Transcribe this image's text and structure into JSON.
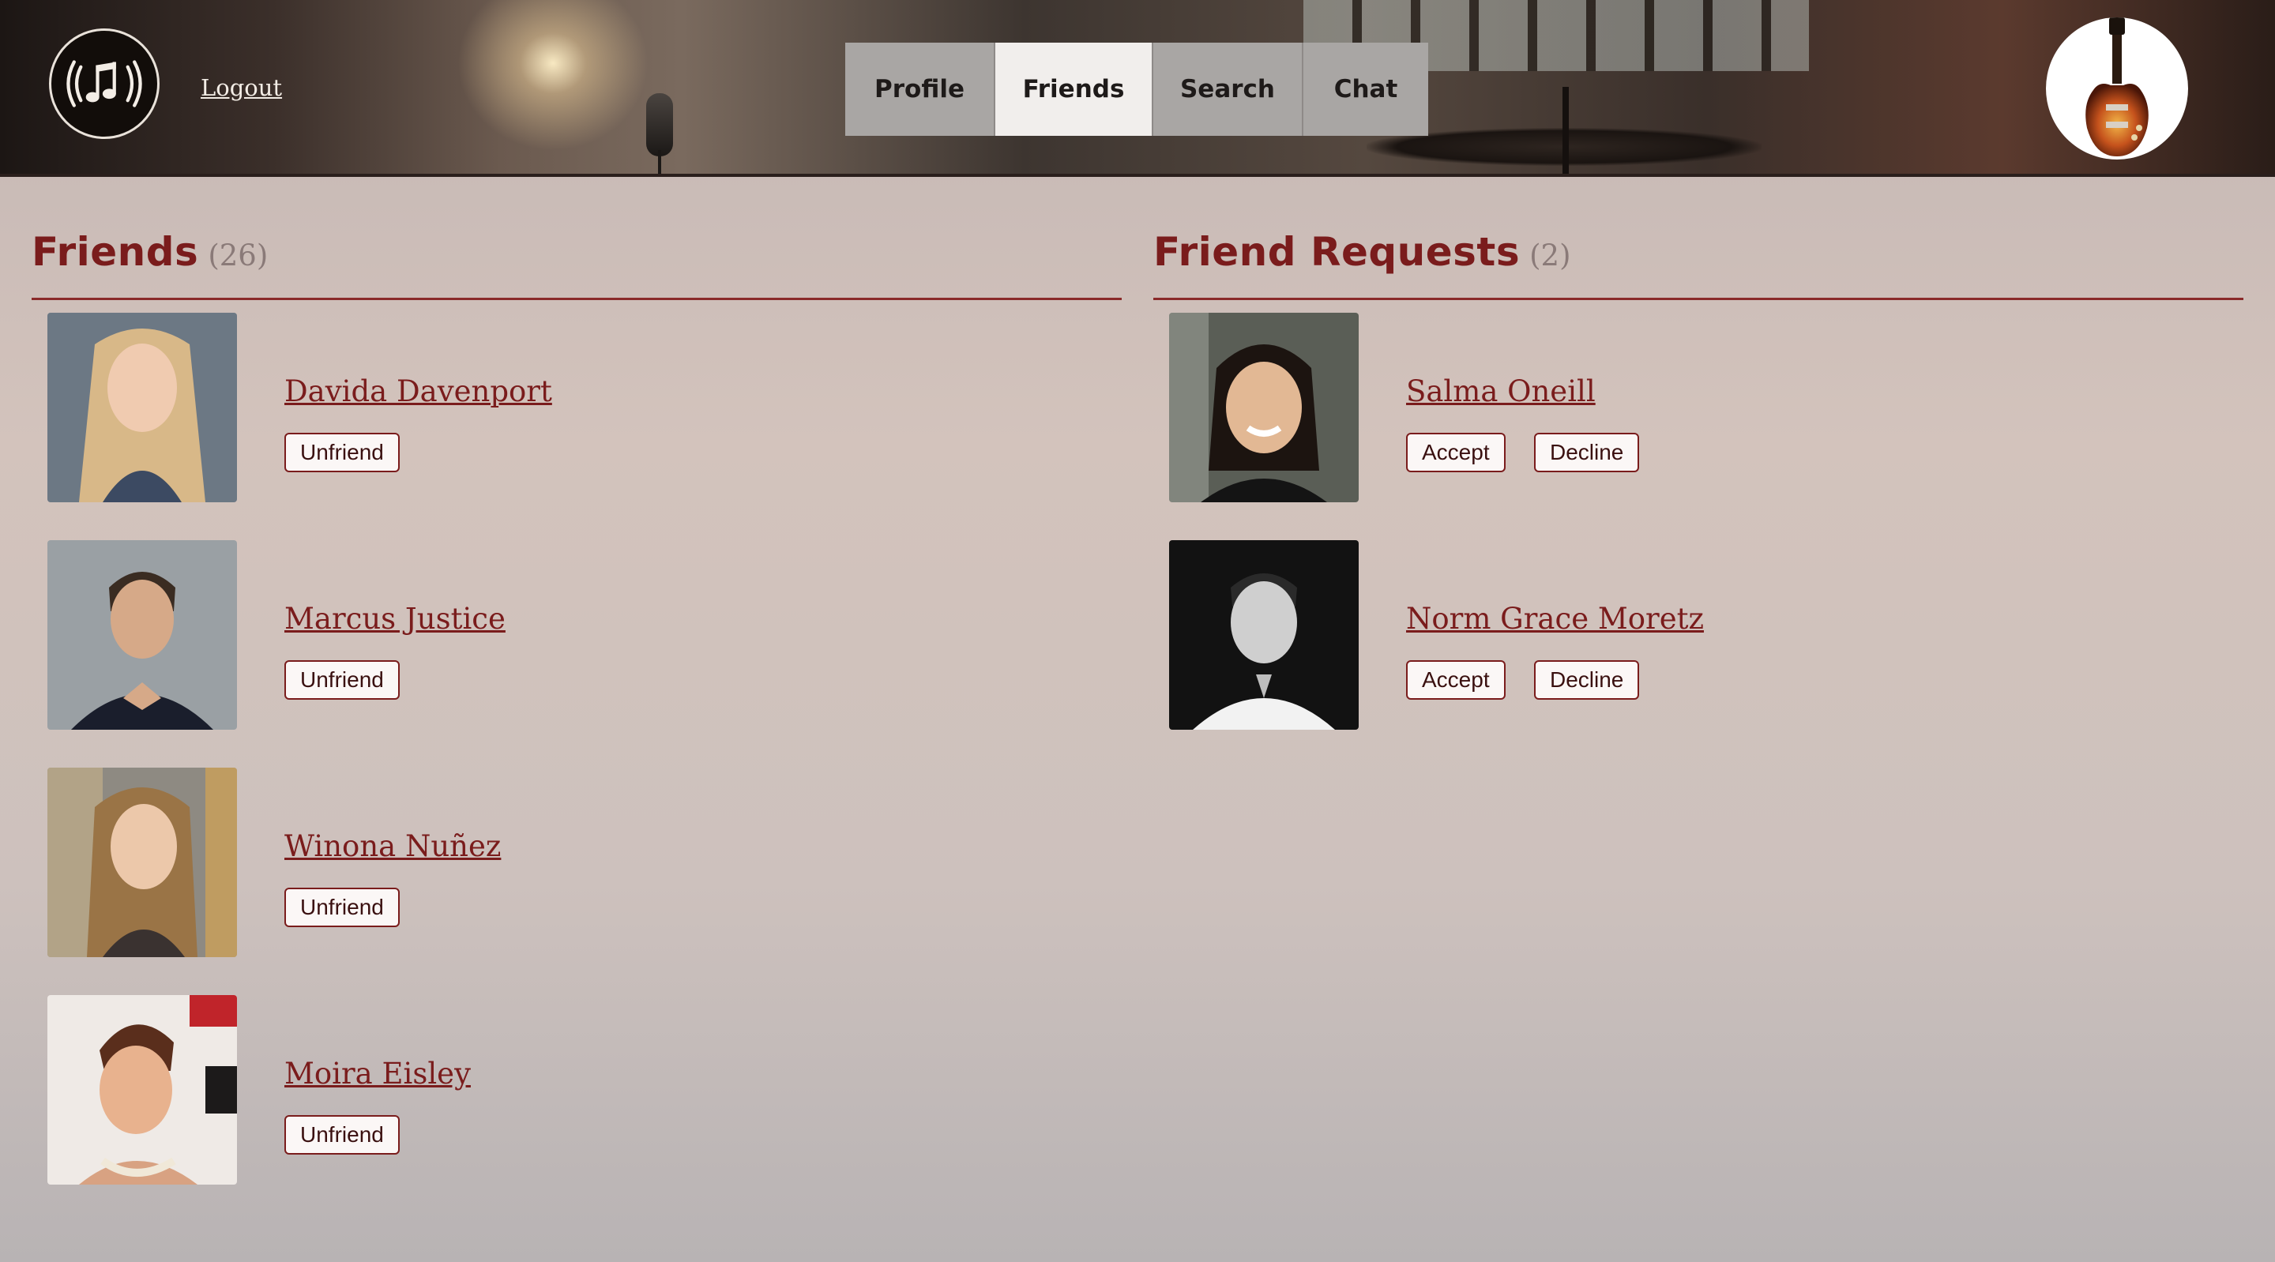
{
  "header": {
    "logout_label": "Logout",
    "tabs": [
      {
        "label": "Profile",
        "active": false
      },
      {
        "label": "Friends",
        "active": true
      },
      {
        "label": "Search",
        "active": false
      },
      {
        "label": "Chat",
        "active": false
      }
    ]
  },
  "friends": {
    "title": "Friends",
    "count": "(26)",
    "items": [
      {
        "name": "Davida Davenport",
        "action": "Unfriend"
      },
      {
        "name": "Marcus Justice",
        "action": "Unfriend"
      },
      {
        "name": "Winona Nuñez",
        "action": "Unfriend"
      },
      {
        "name": "Moira Eisley",
        "action": "Unfriend"
      }
    ]
  },
  "requests": {
    "title": "Friend Requests",
    "count": "(2)",
    "items": [
      {
        "name": "Salma Oneill",
        "accept": "Accept",
        "decline": "Decline"
      },
      {
        "name": "Norm Grace Moretz",
        "accept": "Accept",
        "decline": "Decline"
      }
    ]
  },
  "colors": {
    "accent": "#7a1c1c",
    "active_tab": "#f1eeec",
    "inactive_tab": "#a9a6a4"
  }
}
